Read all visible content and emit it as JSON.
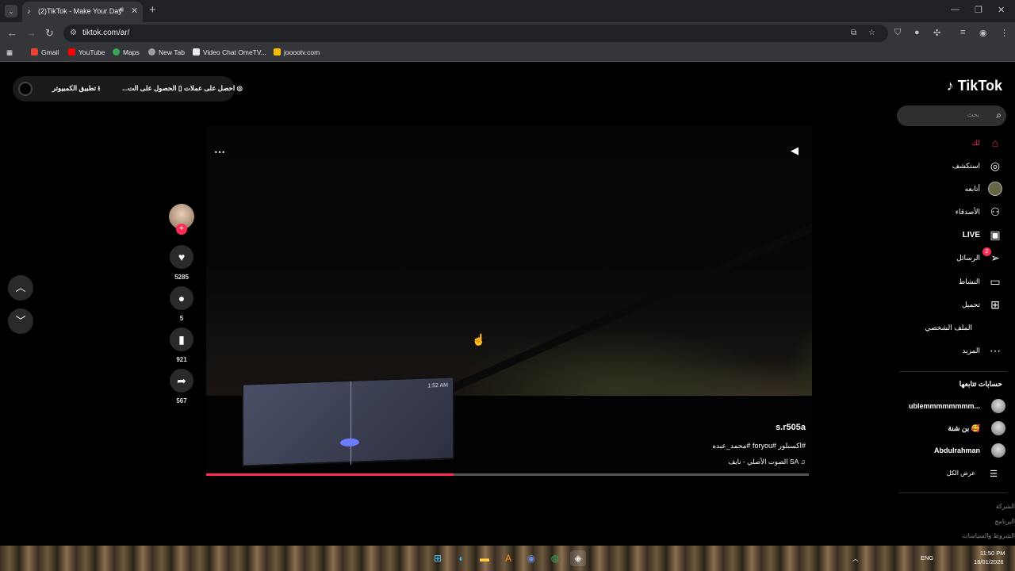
{
  "browser": {
    "tab_title": "(2)TikTok - Make Your Day",
    "url": "tiktok.com/ar/",
    "bookmarks": [
      "Gmail",
      "YouTube",
      "Maps",
      "New Tab",
      "Video Chat OmeTV...",
      "jooootv.com"
    ]
  },
  "topbar": {
    "get_coins": "احصل على عملات",
    "get_app": "الحصول على الت...",
    "desktop_app": "تطبيق الكمبيوتر"
  },
  "brand": {
    "logo": "TikTok"
  },
  "search": {
    "placeholder": "بحث"
  },
  "sidebar": {
    "items": [
      {
        "label": "لك",
        "icon": "home-icon"
      },
      {
        "label": "استكشف",
        "icon": "compass-icon"
      },
      {
        "label": "أتابعه",
        "icon": "avatar-icon"
      },
      {
        "label": "الأصدقاء",
        "icon": "friends-icon"
      },
      {
        "label": "LIVE",
        "icon": "live-icon"
      },
      {
        "label": "الرسائل",
        "icon": "send-icon",
        "badge": "2"
      },
      {
        "label": "النشاط",
        "icon": "inbox-icon"
      },
      {
        "label": "تحميل",
        "icon": "upload-icon"
      },
      {
        "label": "الملف الشخصي",
        "icon": "profile-icon"
      },
      {
        "label": "المزيد",
        "icon": "more-icon"
      }
    ],
    "following_title": "حسابات تتابعها",
    "following": [
      {
        "name": "ublemmmmmmmm..."
      },
      {
        "name": "بن شنة 🥰"
      },
      {
        "name": "Abdulrahman"
      }
    ],
    "see_all": "عرض الكل",
    "footer_links": [
      "الشركة",
      "البرنامج",
      "الشروط والسياسات"
    ]
  },
  "video": {
    "author": "s.r505a",
    "caption": "#اكسبلور #foryou #محمد_عبده",
    "music": "SA الصوت الأصلي - نايف",
    "dash_time": "1:52 AM",
    "progress": 0.41,
    "likes": "5285",
    "comments": "5",
    "saves": "921",
    "shares": "567"
  },
  "taskbar": {
    "lang": "ENG",
    "time": "11:50 PM",
    "date": "18/01/2026"
  },
  "colors": {
    "accent": "#fe2c55",
    "bg": "#000000"
  }
}
